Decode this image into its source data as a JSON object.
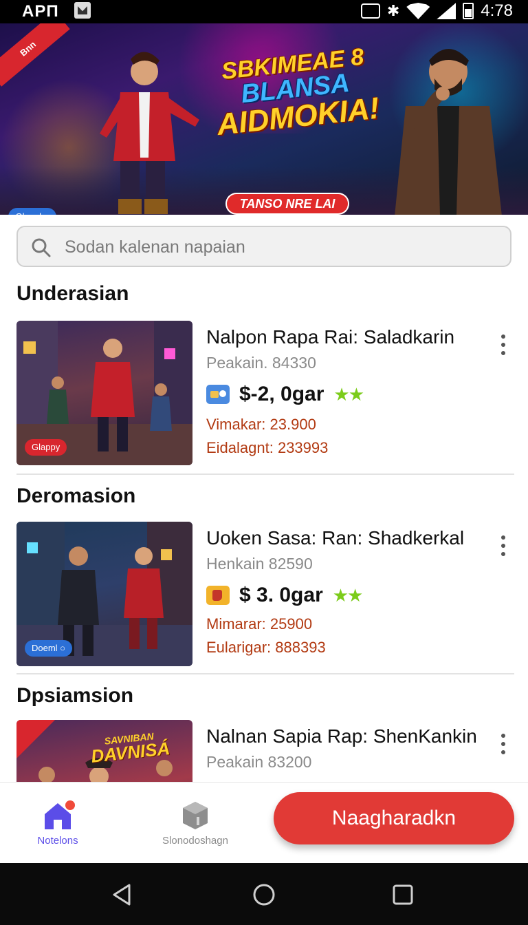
{
  "status_bar": {
    "carrier": "APΠ",
    "time": "4:78"
  },
  "hero": {
    "ribbon_text": "Bnn",
    "title_line1": "SBKIMEAE 8",
    "title_line2": "BLANSA",
    "title_line3": "AIDMOKIA!",
    "cta_label": "TANSO NRE LAI",
    "badge_label": "Glopal ○"
  },
  "search": {
    "placeholder": "Sodan kalenan napaian"
  },
  "sections": [
    {
      "title": "Underasian",
      "game": {
        "title": "Nalpon Rapa Rai: Saladkarin",
        "subtitle": "Peakain. 84330",
        "price": "$-2, 0gar",
        "stars": "★★",
        "stat1": "Vimakar: 23.900",
        "stat2": "Eidalagnt: 233993",
        "thumb_tag": "Glappy"
      }
    },
    {
      "title": "Deromasion",
      "game": {
        "title": "Uoken Sasa: Ran: Shadkerkal",
        "subtitle": "Henkain 82590",
        "price": "$ 3. 0gar",
        "stars": "★★",
        "stat1": "Mimarar: 25900",
        "stat2": "Eularigar: 888393",
        "thumb_tag": "Doeml ○"
      }
    },
    {
      "title": "Dpsiamsion",
      "game": {
        "title": "Nalnan Sapia Rap: ShenKankin",
        "subtitle": "Peakain 83200",
        "thumb_title_line1": "SAVNIBAN",
        "thumb_title_line2": "DAVNISÁ"
      }
    }
  ],
  "bottom_nav": {
    "home_label": "Notelons",
    "store_label": "Slonodoshagn",
    "primary_button": "Naagharadkn"
  },
  "colors": {
    "accent_red": "#e13a36",
    "stars_green": "#7ccc1b",
    "stat_text": "#b23a12",
    "home_icon": "#5b4de8"
  }
}
